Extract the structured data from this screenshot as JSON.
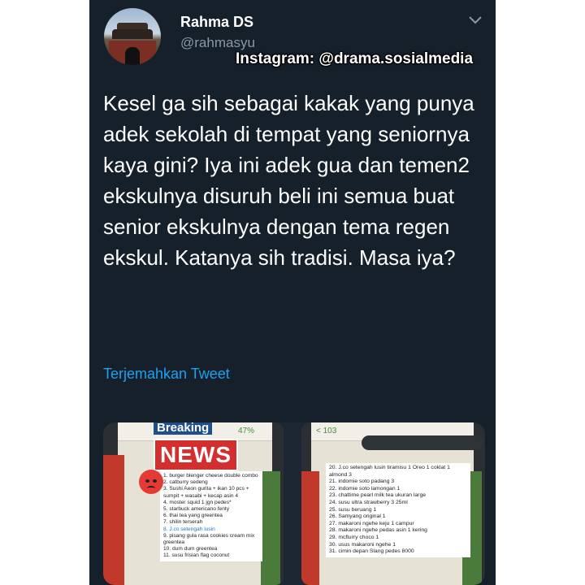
{
  "tweet": {
    "name": "Rahma DS",
    "handle": "@rahmasyu",
    "watermark": "Instagram: @drama.sosialmedia",
    "text": "Kesel ga sih sebagai kakak yang punya adek sekolah di tempat yang seniornya kaya gini? Iya ini adek gua dan temen2 ekskulnya disuruh beli ini semua buat senior ekskulnya dengan tema regen ekskul. Katanya sih tradisi. Masa iya?",
    "translate": "Terjemahkan Tweet"
  },
  "icons": {
    "more": "chevron-down-icon",
    "angry": "angry-face-emoji"
  },
  "media": {
    "left": {
      "breaking": "Breaking",
      "news": "NEWS",
      "status": "47%",
      "items": [
        "1. burger blenger cheese double combo",
        "2. catburry sedeng",
        "3. Sushi Aeon gurita + ikan 10 pcs + sumpit + wasabi + kecap asin 4",
        "4. moster squid 1 jgn pedes*",
        "5. starbuck americano fenty",
        "6. thai tea yang greentea",
        "7. shilin terserah",
        "8. J.co setengah lusin",
        "9. pisang gula rasa cookies cream mix greentea",
        "10. dum dum greentea",
        "11. susu frisian flag coconut"
      ]
    },
    "right": {
      "back": "< 103",
      "items": [
        "20. J.co setengah lusin tiramisu 1 Oreo 1 coklat 1 almond 3",
        "21. indomie soto padang 3",
        "22. indomie soto lamongan 1",
        "23. chattime pearl milk tea ukuran large",
        "24. susu ultra strawberry 3 25ml",
        "25. susu beruang 1",
        "26. Samyang original 1",
        "27. makaroni ngehe keju 1 campur",
        "28. makaroni ngehe pedas asin 1 kering",
        "29. mcflurry choco 1",
        "30. usus makaroni ngehe 1",
        "31. cimin depan Slang pedes 8000"
      ]
    }
  },
  "colors": {
    "background": "#15202b",
    "text": "#ffffff",
    "muted": "#8899a6",
    "link": "#1da1f2"
  }
}
